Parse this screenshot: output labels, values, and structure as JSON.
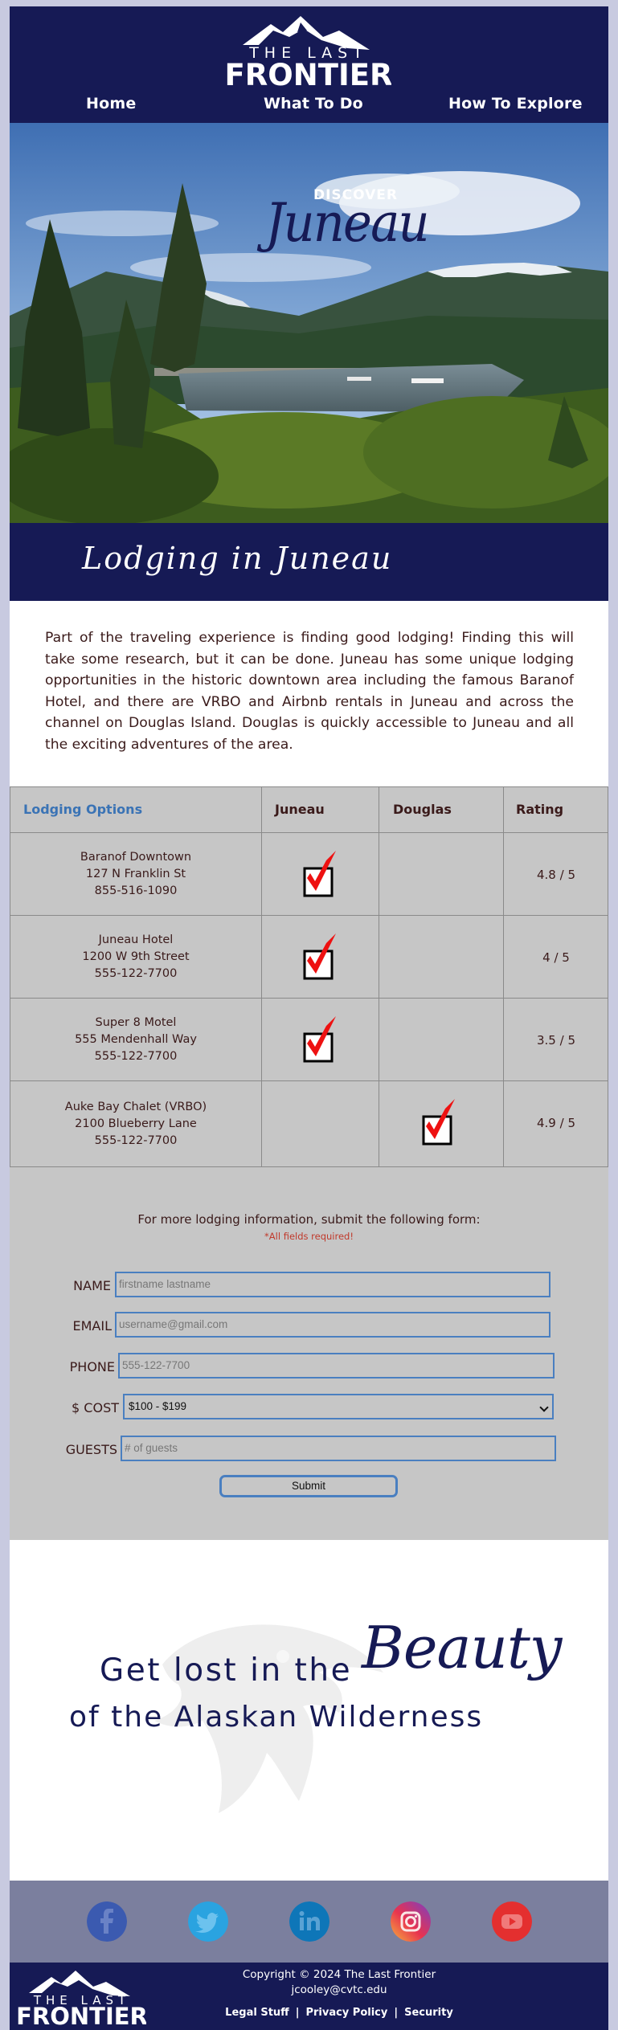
{
  "brand": {
    "logo_top": "THE LAST",
    "logo_main": "FRONTIER",
    "colors": {
      "navy": "#161a55",
      "gray": "#c6c6c6",
      "blue_link": "#3a73b5",
      "required_red": "#c0392b",
      "social_bar": "#7b7f9e"
    }
  },
  "nav": {
    "items": [
      {
        "label": "Home"
      },
      {
        "label": "What To Do"
      },
      {
        "label": "How To Explore"
      }
    ]
  },
  "hero": {
    "discover": "DISCOVER",
    "city": "Juneau"
  },
  "band": {
    "title": "Lodging in Juneau"
  },
  "intro": {
    "text": "Part of the traveling experience is finding good lodging! Finding this will take some research, but it can be done. Juneau has some unique lodging opportunities in the historic downtown area including the famous Baranof Hotel, and there are VRBO and Airbnb rentals in Juneau and across the channel on Douglas Island. Douglas is quickly accessible to Juneau and all the exciting adventures of the area."
  },
  "table": {
    "headers": [
      "Lodging Options",
      "Juneau",
      "Douglas",
      "Rating"
    ],
    "rows": [
      {
        "name": "Baranof Downtown",
        "address": "127 N Franklin St",
        "phone": "855-516-1090",
        "location": "juneau",
        "rating": "4.8 / 5"
      },
      {
        "name": "Juneau Hotel",
        "address": "1200 W 9th Street",
        "phone": "555-122-7700",
        "location": "juneau",
        "rating": "4 / 5"
      },
      {
        "name": "Super 8 Motel",
        "address": "555 Mendenhall Way",
        "phone": "555-122-7700",
        "location": "juneau",
        "rating": "3.5 / 5"
      },
      {
        "name": "Auke Bay Chalet (VRBO)",
        "address": "2100 Blueberry Lane",
        "phone": "555-122-7700",
        "location": "douglas",
        "rating": "4.9 / 5"
      }
    ]
  },
  "form": {
    "intro": "For more lodging information, submit the following form:",
    "required": "*All fields required!",
    "fields": {
      "name": {
        "label": "NAME",
        "placeholder": "firstname lastname"
      },
      "email": {
        "label": "EMAIL",
        "placeholder": "username@gmail.com"
      },
      "phone": {
        "label": "PHONE",
        "placeholder": "555-122-7700"
      },
      "cost": {
        "label": "$ COST",
        "value": "$100 - $199"
      },
      "guests": {
        "label": "GUESTS",
        "placeholder": "# of guests"
      }
    },
    "submit": "Submit"
  },
  "tagline": {
    "line1": "Get lost in the",
    "beauty": "Beauty",
    "line2": "of the Alaskan Wilderness"
  },
  "social": {
    "icons": [
      "facebook-icon",
      "twitter-icon",
      "linkedin-icon",
      "instagram-icon",
      "youtube-icon"
    ]
  },
  "footer": {
    "copyright": "Copyright © 2024 The Last Frontier",
    "email": "jcooley@cvtc.edu",
    "links": [
      "Legal Stuff",
      "Privacy Policy",
      "Security"
    ],
    "separator": "|"
  }
}
